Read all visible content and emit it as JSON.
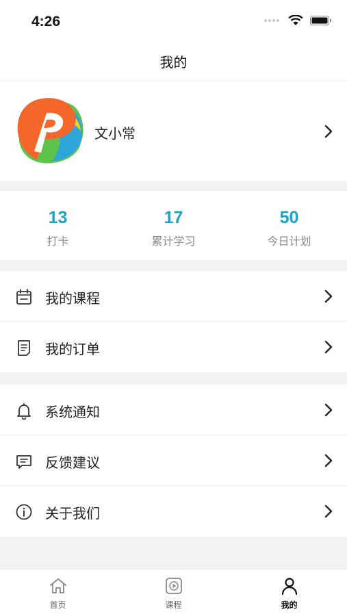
{
  "status_bar": {
    "time": "4:26"
  },
  "header": {
    "title": "我的"
  },
  "profile": {
    "name": "文小常"
  },
  "stats": [
    {
      "value": "13",
      "label": "打卡"
    },
    {
      "value": "17",
      "label": "累计学习"
    },
    {
      "value": "50",
      "label": "今日计划"
    }
  ],
  "menu_group_1": [
    {
      "label": "我的课程",
      "icon": "calendar-icon"
    },
    {
      "label": "我的订单",
      "icon": "document-icon"
    }
  ],
  "menu_group_2": [
    {
      "label": "系统通知",
      "icon": "bell-icon"
    },
    {
      "label": "反馈建议",
      "icon": "message-icon"
    },
    {
      "label": "关于我们",
      "icon": "info-icon"
    }
  ],
  "tab_bar": {
    "active": "我的",
    "tabs": [
      {
        "label": "首页",
        "icon": "home-icon"
      },
      {
        "label": "课程",
        "icon": "play-icon"
      },
      {
        "label": "我的",
        "icon": "user-icon"
      }
    ]
  },
  "colors": {
    "accent": "#1fa3c4",
    "background": "#f2f2f4"
  }
}
